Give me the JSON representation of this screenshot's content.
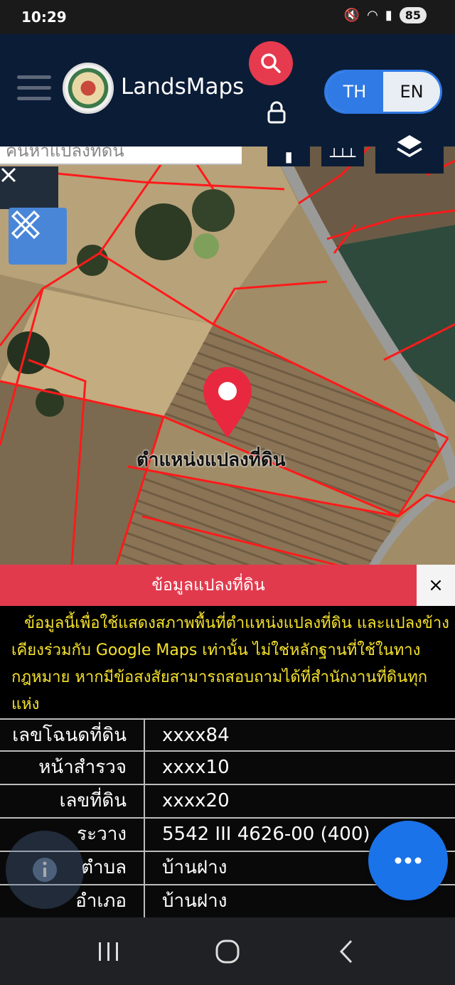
{
  "status": {
    "time": "10:29",
    "battery": "85"
  },
  "header": {
    "brand": "LandsMaps",
    "lang_th": "TH",
    "lang_en": "EN"
  },
  "map": {
    "search_placeholder": "ค้นหาแปลงที่ดิน",
    "pin_label": "ตำแหน่งแปลงที่ดิน"
  },
  "info": {
    "title": "ข้อมูลแปลงที่ดิน",
    "close": "×",
    "notice": "ข้อมูลนี้เพื่อใช้แสดงสภาพพื้นที่ตำแหน่งแปลงที่ดิน และแปลงข้างเคียงร่วมกับ Google Maps เท่านั้น ไม่ใช่หลักฐานที่ใช้ในทางกฎหมาย หากมีข้อสงสัยสามารถสอบถามได้ที่สำนักงานที่ดินทุกแห่ง",
    "rows": [
      {
        "label": "เลขโฉนดที่ดิน",
        "value": "xxxx84"
      },
      {
        "label": "หน้าสำรวจ",
        "value": "xxxx10"
      },
      {
        "label": "เลขที่ดิน",
        "value": "xxxx20"
      },
      {
        "label": "ระวาง",
        "value": "5542 III 4626-00 (400)"
      },
      {
        "label": "ตำบล",
        "value": "บ้านฝาง"
      },
      {
        "label": "อำเภอ",
        "value": "บ้านฝาง"
      }
    ]
  },
  "colors": {
    "header_bg": "#0b1c36",
    "accent_red": "#e23a4d",
    "accent_blue": "#2f7ae5",
    "notice_text": "#f5e12c",
    "parcel_line": "#ff1a1a"
  },
  "icons": [
    "search-icon",
    "lock-icon",
    "layers-icon",
    "close-icon",
    "ruler-pencil-icon",
    "map-pin-icon",
    "more-icon",
    "info-icon",
    "recent-apps-icon",
    "home-icon",
    "back-icon"
  ]
}
